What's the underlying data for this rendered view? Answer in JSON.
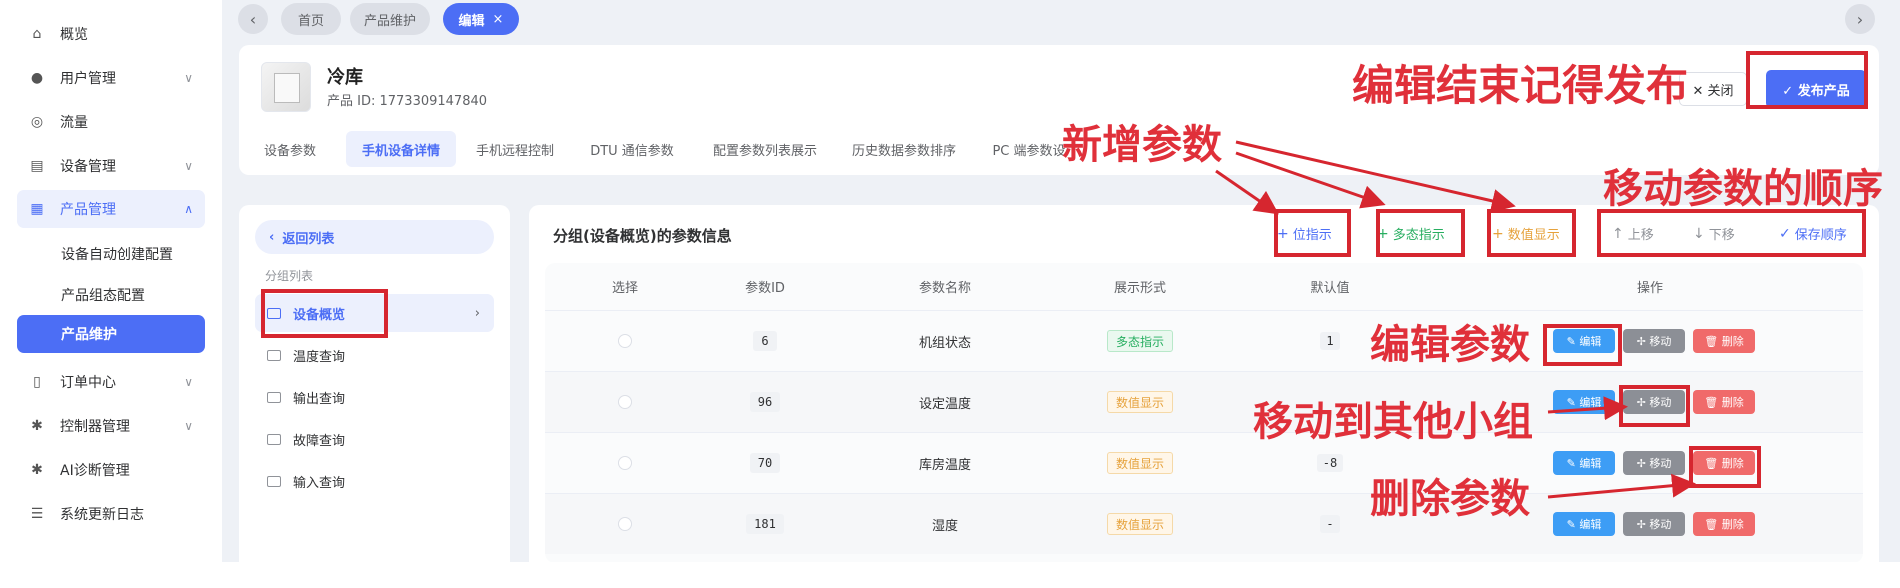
{
  "sidebar": {
    "items": [
      {
        "label": "概览",
        "icon": "home-icon",
        "glyph": "⌂"
      },
      {
        "label": "用户管理",
        "icon": "user-icon",
        "glyph": "●",
        "chevron": "∨"
      },
      {
        "label": "流量",
        "icon": "traffic-icon",
        "glyph": "◎"
      },
      {
        "label": "设备管理",
        "icon": "device-icon",
        "glyph": "▤",
        "chevron": "∨"
      },
      {
        "label": "产品管理",
        "icon": "product-icon",
        "glyph": "▦",
        "chevron": "∧"
      },
      {
        "label": "订单中心",
        "icon": "order-icon",
        "glyph": "▯",
        "chevron": "∨"
      },
      {
        "label": "控制器管理",
        "icon": "controller-icon",
        "glyph": "✱",
        "chevron": "∨"
      },
      {
        "label": "AI诊断管理",
        "icon": "ai-diagnosis-icon",
        "glyph": "✱"
      },
      {
        "label": "系统更新日志",
        "icon": "log-icon",
        "glyph": "☰"
      }
    ],
    "product_sub": [
      "设备自动创建配置",
      "产品组态配置",
      "产品维护"
    ]
  },
  "tabs_bar": {
    "prev_glyph": "‹",
    "next_glyph": "›",
    "tags": [
      "首页",
      "产品维护",
      "编辑"
    ],
    "close_glyph": "×"
  },
  "product": {
    "name": "冷库",
    "id_text": "产品 ID: 1773309147840",
    "tabs": [
      "设备参数",
      "手机设备详情",
      "手机远程控制",
      "DTU 通信参数",
      "配置参数列表展示",
      "历史数据参数排序",
      "PC 端参数设"
    ],
    "close_label": "✕ 关闭",
    "publish_label": "✓ 发布产品"
  },
  "groups": {
    "back_label": "返回列表",
    "back_glyph": "‹",
    "title": "分组列表",
    "items": [
      "设备概览",
      "温度查询",
      "输出查询",
      "故障查询",
      "输入查询"
    ],
    "chevron": "›"
  },
  "params": {
    "title": "分组(设备概览)的参数信息",
    "actions": [
      {
        "sym": "+",
        "label": "位指示",
        "color": "#4c6ef5"
      },
      {
        "sym": "+",
        "label": "多态指示",
        "color": "#27ae60"
      },
      {
        "sym": "+",
        "label": "数值显示",
        "color": "#e6a23c"
      },
      {
        "sym": "↑",
        "label": "上移",
        "color": "#909399"
      },
      {
        "sym": "↓",
        "label": "下移",
        "color": "#909399"
      },
      {
        "sym": "✓",
        "label": "保存顺序",
        "color": "#4c6ef5"
      }
    ],
    "columns": [
      "选择",
      "参数ID",
      "参数名称",
      "展示形式",
      "默认值",
      "操作"
    ],
    "rows": [
      {
        "id": "6",
        "name": "机组状态",
        "display": "多态指示",
        "default": "1"
      },
      {
        "id": "96",
        "name": "设定温度",
        "display": "数值显示",
        "default": ""
      },
      {
        "id": "70",
        "name": "库房温度",
        "display": "数值显示",
        "default": "-8"
      },
      {
        "id": "181",
        "name": "湿度",
        "display": "数值显示",
        "default": "-"
      }
    ],
    "op_labels": {
      "edit": "✎ 编辑",
      "move": "✢ 移动",
      "delete": "🗑 删除"
    }
  },
  "annotations": {
    "publish": "编辑结束记得发布",
    "add_params": "新增参数",
    "move_order": "移动参数的顺序",
    "edit_param": "编辑参数",
    "move_group": "移动到其他小组",
    "delete_param": "删除参数"
  },
  "colors": {
    "accent": "#4c6ef5",
    "annotation": "#e0303a",
    "success": "#27ae60",
    "warning": "#e6a23c",
    "danger": "#f06a6a"
  }
}
